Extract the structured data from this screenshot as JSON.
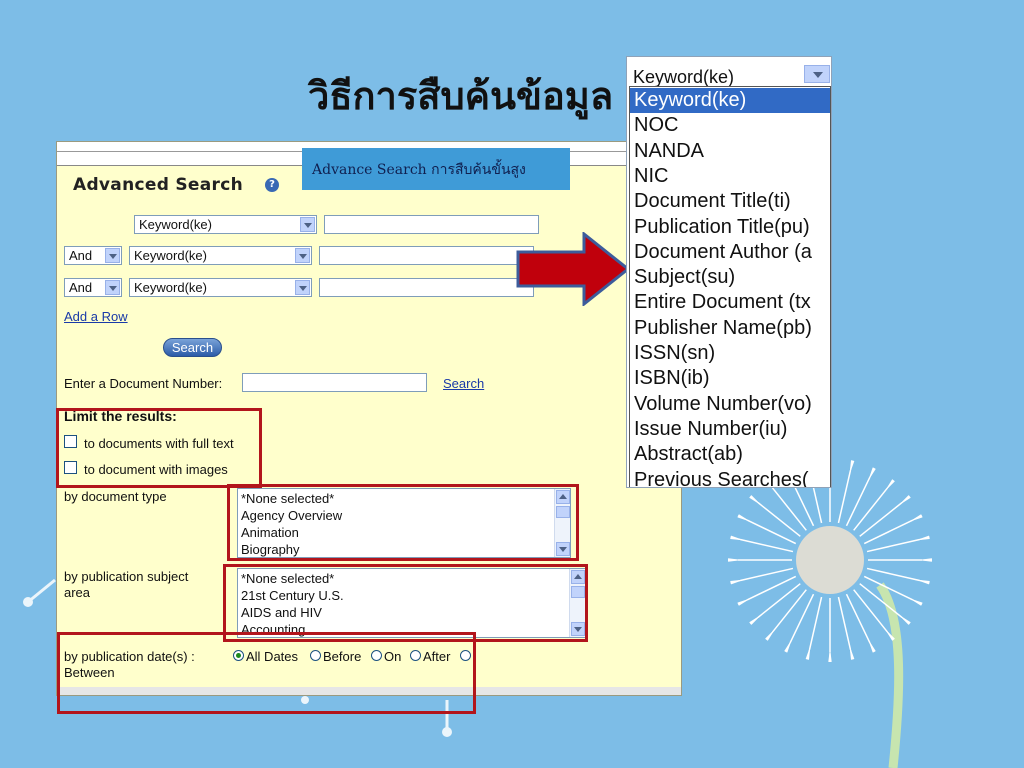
{
  "slide": {
    "title": "วิธีการสืบค้นข้อมูล",
    "caption": "Advance Search การสืบค้นขั้นสูง"
  },
  "advanced_search": {
    "title": "Advanced Search",
    "help_icon": "?",
    "rows": [
      {
        "field": "Keyword(ke)",
        "operator": "",
        "value": ""
      },
      {
        "field": "Keyword(ke)",
        "operator": "And",
        "value": ""
      },
      {
        "field": "Keyword(ke)",
        "operator": "And",
        "value": ""
      }
    ],
    "add_row_link": "Add a Row",
    "search_button": "Search",
    "document_number_label": "Enter a Document Number:",
    "document_number_value": "",
    "document_number_search_link": "Search"
  },
  "limits": {
    "title": "Limit the results:",
    "full_text_label": "to documents with full text",
    "images_label": "to document with images",
    "full_text_checked": false,
    "images_checked": false,
    "document_type_label": "by document type",
    "document_type_options": [
      "*None selected*",
      "Agency Overview",
      "Animation",
      "Biography"
    ],
    "subject_area_label_line1": "by publication subject",
    "subject_area_label_line2": "area",
    "subject_area_options": [
      "*None selected*",
      "21st Century U.S.",
      "AIDS and HIV",
      "Accounting"
    ],
    "date_label_line1": "by publication date(s) :",
    "date_label_line2": "Between",
    "date_options": [
      "All Dates",
      "Before",
      "On",
      "After"
    ],
    "date_selected": "All Dates"
  },
  "field_dropdown": {
    "current_value": "Keyword(ke)",
    "options": [
      "Keyword(ke)",
      "NOC",
      "NANDA",
      "NIC",
      "Document Title(ti)",
      "Publication Title(pu)",
      "Document Author (a",
      "Subject(su)",
      "Entire Document (tx",
      "Publisher Name(pb)",
      "ISSN(sn)",
      "ISBN(ib)",
      "Volume Number(vo)",
      "Issue Number(iu)",
      "Abstract(ab)",
      "Previous Searches("
    ],
    "selected_index": 0
  },
  "colors": {
    "background": "#7dbde7",
    "panel": "#ffffcc",
    "highlight_box": "#b2151c",
    "pointer_arrow": "#c0000c",
    "selection": "#316ac5"
  }
}
